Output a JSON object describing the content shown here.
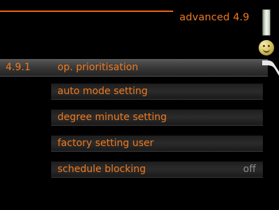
{
  "header": {
    "title": "advanced 4.9",
    "icons": [
      "level-bar-icon",
      "smiley-icon"
    ]
  },
  "menu": {
    "selected_number": "4.9.1",
    "items": [
      {
        "label": "op. prioritisation",
        "value": ""
      },
      {
        "label": "auto mode setting",
        "value": ""
      },
      {
        "label": "degree minute setting",
        "value": ""
      },
      {
        "label": "factory setting user",
        "value": ""
      },
      {
        "label": "schedule blocking",
        "value": "off"
      }
    ]
  },
  "colors": {
    "accent": "#f07a1e",
    "background": "#000000",
    "value_text": "#8a8a8a"
  }
}
